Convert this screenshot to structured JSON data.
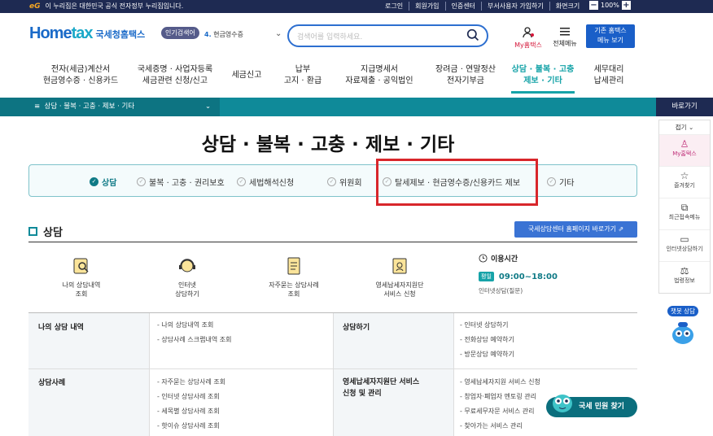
{
  "topbar": {
    "gov_logo": "eG",
    "gov_text": "이 누리집은 대한민국 공식 전자정부 누리집입니다.",
    "links": [
      "로그인",
      "회원가입",
      "인증센터",
      "부서사용자 가입하기",
      "화면크기"
    ],
    "zoom_minus": "−",
    "zoom_value": "100%",
    "zoom_plus": "+"
  },
  "header": {
    "logo_home": "Home",
    "logo_tax": "tax",
    "logo_org": "국세청홈택스",
    "popular_label": "인기검색어",
    "popular_rank": "4.",
    "popular_value": "현금영수증",
    "search_placeholder": "검색어를 입력하세요.",
    "my_hometax": "My홈택스",
    "all_menu": "전체메뉴",
    "basic_menu_line1": "기존 홈택스",
    "basic_menu_line2": "메뉴 보기"
  },
  "gnb": [
    {
      "line1": "전자(세금)계산서",
      "line2": "현금영수증 · 신용카드"
    },
    {
      "line1": "국세증명 · 사업자등록",
      "line2": "세금관련 신청/신고"
    },
    {
      "line1": "세금신고",
      "line2": ""
    },
    {
      "line1": "납부",
      "line2": "고지 · 환급"
    },
    {
      "line1": "지급명세서",
      "line2": "자료제출 · 공익법인"
    },
    {
      "line1": "장려금 · 연말정산",
      "line2": "전자기부금"
    },
    {
      "line1": "상담 · 불복 · 고충",
      "line2": "제보 · 기타"
    },
    {
      "line1": "세무대리",
      "line2": "납세관리"
    }
  ],
  "breadcrumb": {
    "menu_icon": "≡",
    "text": "상담 · 불복 · 고충 · 제보 · 기타"
  },
  "page_title": "상담 · 불복 · 고충 · 제보 · 기타",
  "tabs": [
    "상담",
    "불복 · 고충 · 권리보호",
    "세법해석신청",
    "위원회",
    "탈세제보 · 현금영수증/신용카드 제보",
    "기타"
  ],
  "section": {
    "title": "상담",
    "ext_button": "국세상담센터 홈페이지 바로가기"
  },
  "quick": [
    {
      "line1": "나의 상담내역",
      "line2": "조회"
    },
    {
      "line1": "인터넷",
      "line2": "상담하기"
    },
    {
      "line1": "자주묻는 상담사례",
      "line2": "조회"
    },
    {
      "line1": "영세납세자지원단",
      "line2": "서비스 신청"
    }
  ],
  "hours": {
    "title": "이용시간",
    "badge": "평일",
    "time": "09:00~18:00",
    "note": "인터넷상담(질문)"
  },
  "table": {
    "r1c1_head": "나의 상담 내역",
    "r1c1_items": [
      "- 나의 상담내역 조회",
      "- 상담사례 스크랩내역 조회"
    ],
    "r1c2_head": "상담하기",
    "r1c2_items": [
      "- 인터넷 상담하기",
      "- 전화상담 예약하기",
      "- 방문상담 예약하기"
    ],
    "r2c1_head": "상담사례",
    "r2c1_items": [
      "- 자주묻는 상담사례 조회",
      "- 인터넷 상담사례 조회",
      "- 세목별 상담사례 조회",
      "- 핫이슈 상담사례 조회"
    ],
    "r2c2_head_line1": "영세납세자지원단 서비스",
    "r2c2_head_line2": "신청 및 관리",
    "r2c2_items": [
      "- 영세납세자지원 서비스 신청",
      "- 창업자·폐업자 멘토링 관리",
      "- 무료세무자문 서비스 관리",
      "- 찾아가는 서비스 관리"
    ]
  },
  "right_rail": {
    "title": "바로가기",
    "fold": "접기",
    "items": [
      "My홈택스",
      "즐겨찾기",
      "최근접속메뉴",
      "인터넷상담하기",
      "법령정보"
    ]
  },
  "chatbot_label": "챗봇 상담",
  "float_button": "국세 민원 찾기"
}
